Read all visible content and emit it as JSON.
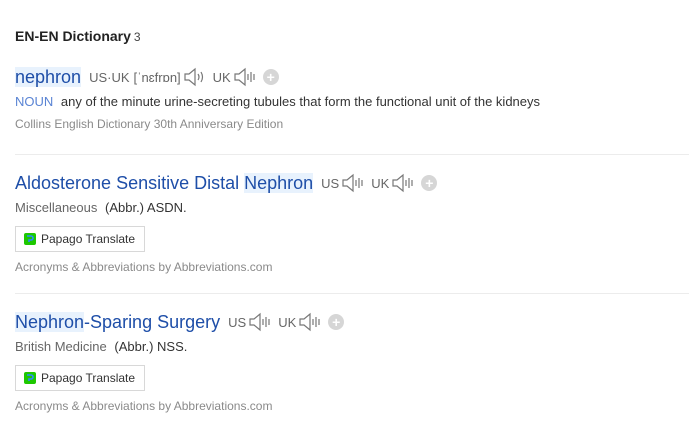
{
  "header": {
    "title": "EN-EN Dictionary",
    "count": "3"
  },
  "entries": [
    {
      "word_highlight": "nephron",
      "us_uk_label": "US·UK",
      "phonetic": "[ˈnɛfrɒn]",
      "uk_label": "UK",
      "pos": "NOUN",
      "definition": "any of the minute urine-secreting tubules that form the functional unit of the kidneys",
      "source": "Collins English Dictionary 30th Anniversary Edition"
    },
    {
      "word_prefix": "Aldosterone Sensitive Distal ",
      "word_highlight": "Nephron",
      "us_label": "US",
      "uk_label": "UK",
      "category": "Miscellaneous",
      "definition": "(Abbr.) ASDN.",
      "translate_label": "Papago Translate",
      "source": "Acronyms & Abbreviations by Abbreviations.com"
    },
    {
      "word_highlight": "Nephron",
      "word_suffix": "-Sparing Surgery",
      "us_label": "US",
      "uk_label": "UK",
      "category": "British Medicine",
      "definition": "(Abbr.) NSS.",
      "translate_label": "Papago Translate",
      "source": "Acronyms & Abbreviations by Abbreviations.com"
    }
  ],
  "icons": {
    "speaker": "speaker-icon",
    "add": "plus-circle-icon",
    "papago": "papago-icon"
  },
  "colors": {
    "link": "#1e4ea8",
    "highlight": "#e8f2fd",
    "pos": "#5a84d4"
  }
}
